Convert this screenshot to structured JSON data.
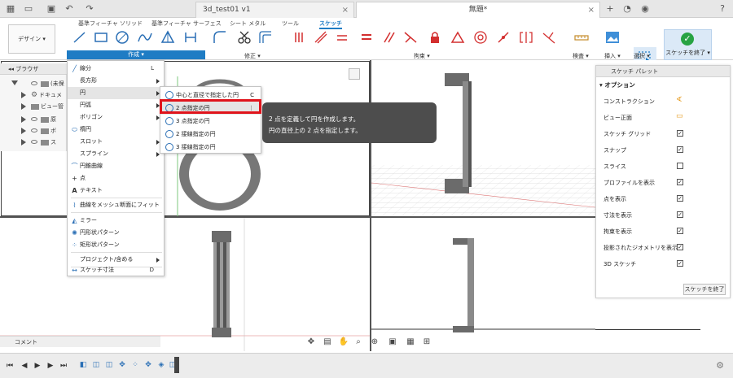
{
  "titlebar": {
    "tabs": [
      {
        "label": "3d_test01 v1"
      },
      {
        "label": "無題*"
      }
    ]
  },
  "ribbon": {
    "tabs": [
      "基準フィーチャ ソリッド",
      "基準フィーチャ サーフェス",
      "シート メタル",
      "ツール",
      "スケッチ"
    ],
    "workspace_label": "デザイン",
    "groups": [
      "作成",
      "修正",
      "拘束",
      "検査",
      "挿入",
      "選択",
      "スケッチを終了"
    ]
  },
  "browser": {
    "title": "ブラウザ",
    "items": [
      "(未保",
      "ドキュメ",
      "ビュー管",
      "原",
      "ボ",
      "ス"
    ]
  },
  "menu": {
    "items": [
      {
        "label": "線分",
        "shortcut": "L"
      },
      {
        "label": "長方形",
        "shortcut": ""
      },
      {
        "label": "円",
        "shortcut": ""
      },
      {
        "label": "円弧",
        "shortcut": ""
      },
      {
        "label": "ポリゴン",
        "shortcut": ""
      },
      {
        "label": "楕円",
        "shortcut": ""
      },
      {
        "label": "スロット",
        "shortcut": ""
      },
      {
        "label": "スプライン",
        "shortcut": ""
      },
      {
        "label": "円錐曲線",
        "shortcut": ""
      },
      {
        "label": "点",
        "shortcut": ""
      },
      {
        "label": "テキスト",
        "shortcut": ""
      },
      {
        "label": "曲線をメッシュ断面にフィット",
        "shortcut": ""
      },
      {
        "label": "ミラー",
        "shortcut": ""
      },
      {
        "label": "円形状パターン",
        "shortcut": ""
      },
      {
        "label": "矩形状パターン",
        "shortcut": ""
      },
      {
        "label": "プロジェクト/含める",
        "shortcut": ""
      },
      {
        "label": "スケッチ寸法",
        "shortcut": "D"
      }
    ]
  },
  "submenu": {
    "items": [
      {
        "label": "中心と直径で指定した円",
        "shortcut": "C"
      },
      {
        "label": "2 点指定の円",
        "shortcut": ""
      },
      {
        "label": "3 点指定の円",
        "shortcut": ""
      },
      {
        "label": "2 接線指定の円",
        "shortcut": ""
      },
      {
        "label": "3 接線指定の円",
        "shortcut": ""
      }
    ]
  },
  "tooltip": {
    "line1": "2 点を定義して円を作成します。",
    "line2": "円の直径上の 2 点を指定します。"
  },
  "palette": {
    "title": "スケッチ パレット",
    "section": "オプション",
    "rows": [
      {
        "label": "コンストラクション",
        "checked": null
      },
      {
        "label": "ビュー正面",
        "checked": null
      },
      {
        "label": "スケッチ グリッド",
        "checked": true
      },
      {
        "label": "スナップ",
        "checked": true
      },
      {
        "label": "スライス",
        "checked": false
      },
      {
        "label": "プロファイルを表示",
        "checked": true
      },
      {
        "label": "点を表示",
        "checked": true
      },
      {
        "label": "寸法を表示",
        "checked": true
      },
      {
        "label": "拘束を表示",
        "checked": true
      },
      {
        "label": "投影されたジオメトリを表示",
        "checked": true
      },
      {
        "label": "3D スケッチ",
        "checked": true
      }
    ],
    "finish_label": "スケッチを終了",
    "check_mark": "✓"
  },
  "comment": {
    "label": "コメント"
  },
  "colors": {
    "accent": "#1f7cc4",
    "highlight": "#e0141c",
    "tooltip_bg": "#4d4d4d",
    "finish_green": "#27a343"
  }
}
